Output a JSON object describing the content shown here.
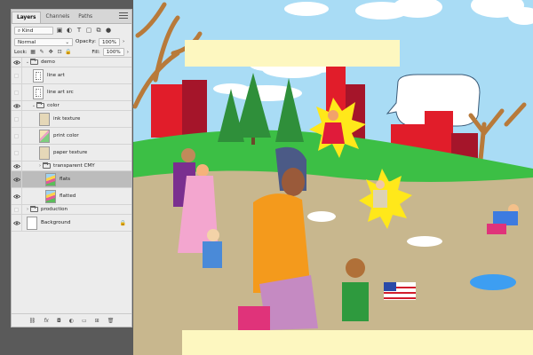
{
  "panel": {
    "tabs": [
      {
        "label": "Layers",
        "active": true
      },
      {
        "label": "Channels",
        "active": false
      },
      {
        "label": "Paths",
        "active": false
      }
    ],
    "filter_label": "Kind",
    "blend_mode": "Normal",
    "opacity_label": "Opacity:",
    "opacity_value": "100%",
    "lock_label": "Lock:",
    "fill_label": "Fill:",
    "fill_value": "100%",
    "layers": [
      {
        "name": "demo",
        "kind": "group",
        "visible": true,
        "expanded": true
      },
      {
        "name": "line art",
        "kind": "line",
        "visible": false
      },
      {
        "name": "line art src",
        "kind": "line",
        "visible": false
      },
      {
        "name": "color",
        "kind": "group",
        "visible": true,
        "expanded": true
      },
      {
        "name": "ink texture",
        "kind": "texture",
        "visible": false
      },
      {
        "name": "print color",
        "kind": "color",
        "visible": false
      },
      {
        "name": "paper texture",
        "kind": "texture",
        "visible": false
      },
      {
        "name": "transparent CMY",
        "kind": "group",
        "visible": true,
        "expanded": false
      },
      {
        "name": "flats",
        "kind": "flat",
        "visible": true,
        "selected": true
      },
      {
        "name": "flatted",
        "kind": "flat",
        "visible": true
      },
      {
        "name": "production",
        "kind": "group",
        "visible": false,
        "expanded": false
      },
      {
        "name": "Background",
        "kind": "background",
        "visible": true,
        "locked": true
      }
    ],
    "footer_icons": [
      "link-icon",
      "fx-icon",
      "mask-icon",
      "adjustment-icon",
      "new-group-icon",
      "new-layer-icon",
      "trash-icon"
    ],
    "fx_label": "fx"
  },
  "colors": {
    "sky": "#a9dcf5",
    "ground": "#c8b78e",
    "grass": "#3cbf45",
    "buildings": "#e11d2a",
    "caption": "#fdf7c0"
  }
}
